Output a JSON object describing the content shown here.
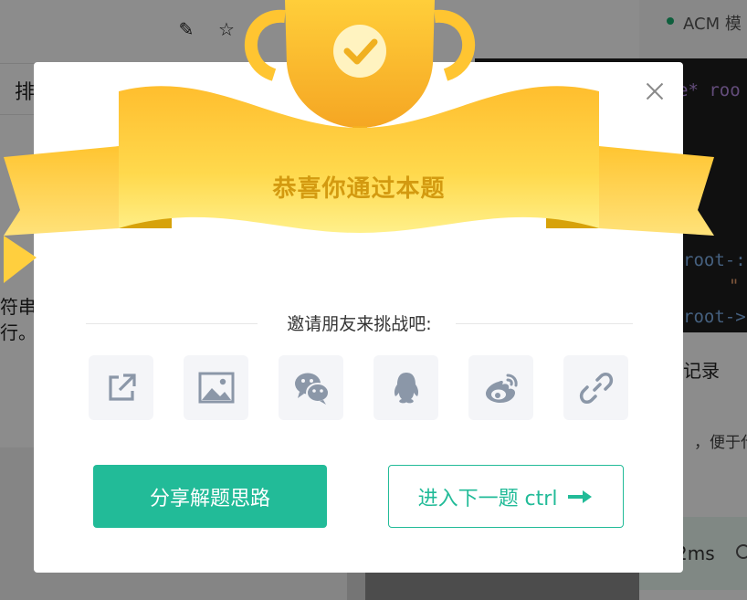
{
  "background": {
    "tab_text": "排",
    "acm_label": "ACM 模",
    "left_text_line1": "符串",
    "left_text_line2": "行。",
    "code_line1": "e* roo",
    "code_line2": "root-:",
    "code_line3": "\"",
    "code_line4": "root->",
    "records_label": "记录",
    "convenient_text": "，便于代",
    "runtime_text": "2ms"
  },
  "modal": {
    "title": "恭喜你通过本题",
    "invite_text": "邀请朋友来挑战吧:",
    "share_buttons": [
      {
        "name": "external-share",
        "icon": "external-link-icon"
      },
      {
        "name": "image-share",
        "icon": "image-icon"
      },
      {
        "name": "wechat-share",
        "icon": "wechat-icon"
      },
      {
        "name": "qq-share",
        "icon": "qq-icon"
      },
      {
        "name": "weibo-share",
        "icon": "weibo-icon"
      },
      {
        "name": "link-share",
        "icon": "link-icon"
      }
    ],
    "share_solution_label": "分享解题思路",
    "next_problem_label": "进入下一题 ctrl"
  },
  "colors": {
    "primary": "#22bb98",
    "gold": "#f5b920",
    "title_gold": "#d39a10"
  }
}
